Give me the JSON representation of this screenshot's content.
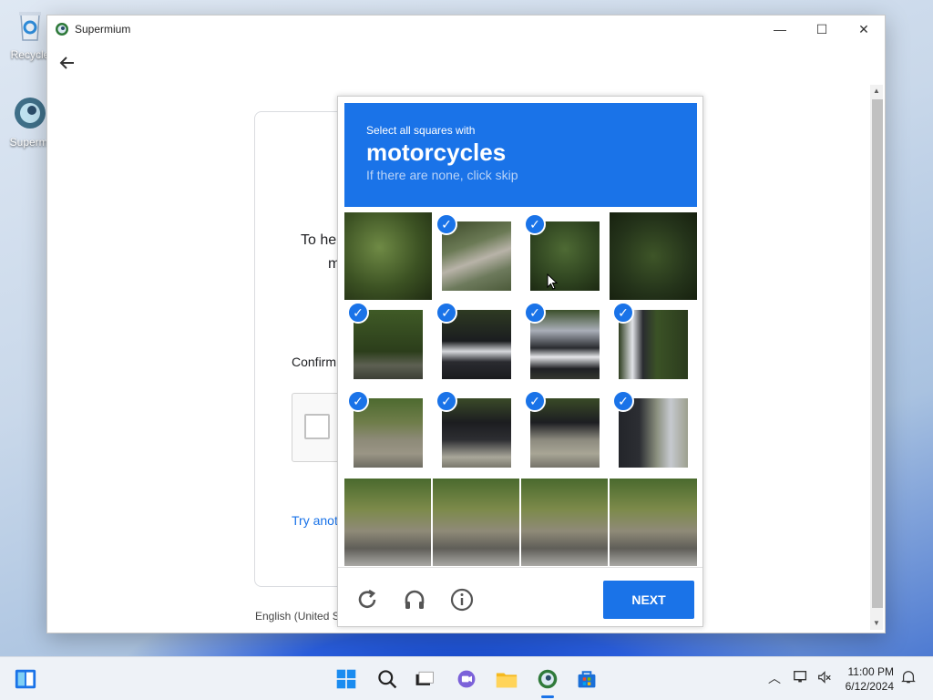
{
  "desktop": {
    "icons": [
      {
        "label": "Recycle"
      },
      {
        "label": "Supermi"
      }
    ]
  },
  "window": {
    "title": "Supermium",
    "controls": {
      "minimize": "—",
      "maximize": "☐",
      "close": "✕"
    }
  },
  "page": {
    "heading_line1": "To he",
    "heading_line2": "m",
    "confirm": "Confirm",
    "try_another": "Try anot",
    "language": "English (United S"
  },
  "captcha": {
    "line1": "Select all squares with",
    "target": "motorcycles",
    "line3": "If there are none, click skip",
    "next_label": "NEXT",
    "tiles": [
      {
        "selected": false
      },
      {
        "selected": true
      },
      {
        "selected": true
      },
      {
        "selected": false
      },
      {
        "selected": true
      },
      {
        "selected": true
      },
      {
        "selected": true
      },
      {
        "selected": true
      },
      {
        "selected": true
      },
      {
        "selected": true
      },
      {
        "selected": true
      },
      {
        "selected": true
      }
    ],
    "tools": [
      "reload-icon",
      "audio-icon",
      "info-icon"
    ]
  },
  "taskbar": {
    "icons": [
      "widgets-icon",
      "start-icon",
      "search-icon",
      "task-view-icon",
      "chat-icon",
      "file-explorer-icon",
      "supermium-icon",
      "store-icon"
    ],
    "time": "11:00 PM",
    "date": "6/12/2024"
  },
  "colors": {
    "accent": "#1a73e8",
    "banner_subtext": "#b9d3f7"
  }
}
